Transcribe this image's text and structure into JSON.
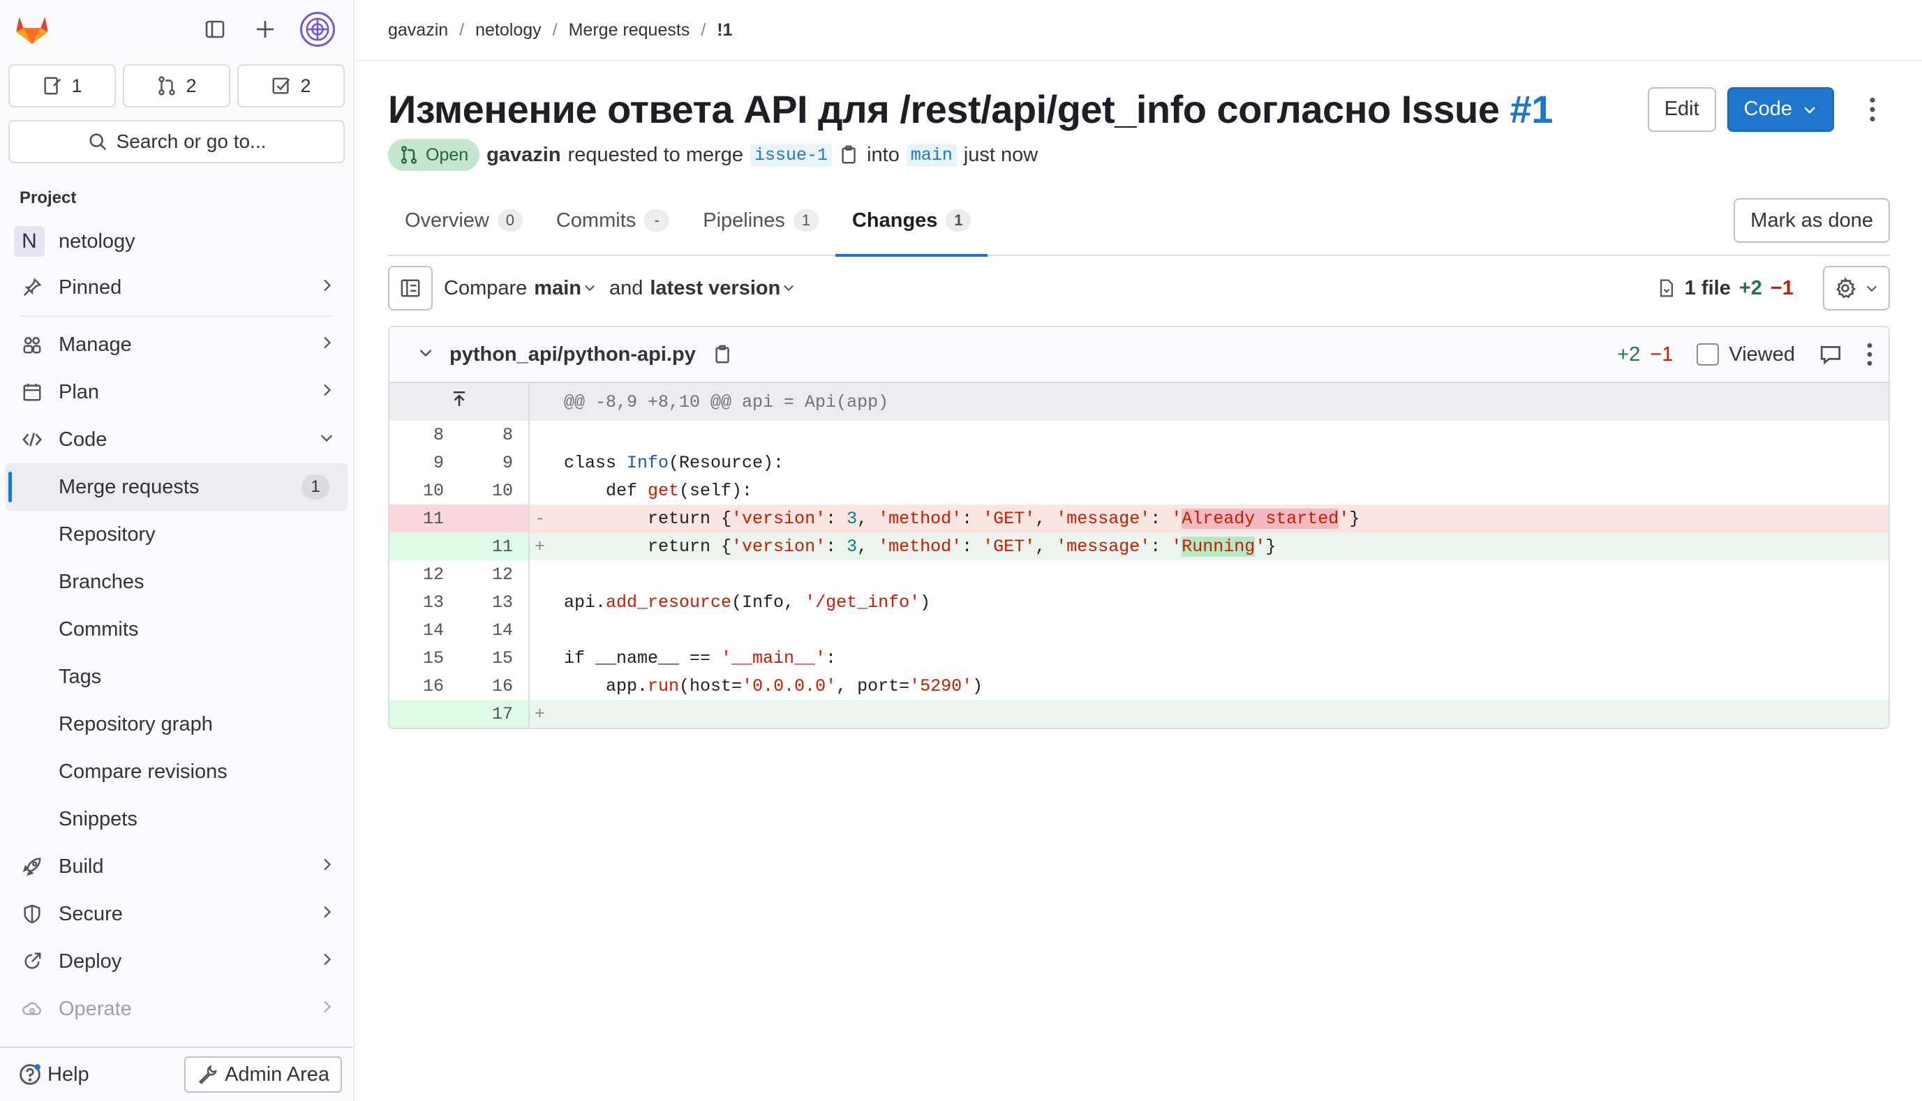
{
  "colors": {
    "accent": "#1f75cb",
    "added": "#217645",
    "removed": "#c91c00",
    "open_badge": "#c3e6cd"
  },
  "sidebar": {
    "counts": [
      {
        "icon": "issues-icon",
        "value": "1"
      },
      {
        "icon": "merge-request-icon",
        "value": "2"
      },
      {
        "icon": "todo-icon",
        "value": "2"
      }
    ],
    "search_label": "Search or go to...",
    "section_title": "Project",
    "project_initial": "N",
    "project_name": "netology",
    "items": {
      "pinned": "Pinned",
      "manage": "Manage",
      "plan": "Plan",
      "code": "Code",
      "build": "Build",
      "secure": "Secure",
      "deploy": "Deploy",
      "operate": "Operate"
    },
    "code_sub": {
      "merge_requests": "Merge requests",
      "merge_requests_count": "1",
      "repository": "Repository",
      "branches": "Branches",
      "commits": "Commits",
      "tags": "Tags",
      "repository_graph": "Repository graph",
      "compare_revisions": "Compare revisions",
      "snippets": "Snippets"
    },
    "help": "Help",
    "admin": "Admin Area"
  },
  "breadcrumb": [
    "gavazin",
    "netology",
    "Merge requests",
    "!1"
  ],
  "mr": {
    "title": "Изменение ответа API для /rest/api/get_info согласно Issue ",
    "title_ref": "#1",
    "edit_label": "Edit",
    "code_label": "Code",
    "status": "Open",
    "author": "gavazin",
    "requested_text": "requested to merge",
    "source_branch": "issue-1",
    "into_text": "into",
    "target_branch": "main",
    "time": "just now"
  },
  "tabs": [
    {
      "label": "Overview",
      "count": "0"
    },
    {
      "label": "Commits",
      "count": "-"
    },
    {
      "label": "Pipelines",
      "count": "1"
    },
    {
      "label": "Changes",
      "count": "1"
    }
  ],
  "mark_done": "Mark as done",
  "compare": {
    "compare_label": "Compare",
    "base": "main",
    "and_label": "and",
    "head": "latest version",
    "files": "1 file",
    "added": "+2",
    "removed": "−1"
  },
  "file": {
    "path": "python_api/python-api.py",
    "added": "+2",
    "removed": "−1",
    "viewed_label": "Viewed",
    "hunk_header": "@@ -8,9 +8,10 @@ api = Api(app)"
  }
}
